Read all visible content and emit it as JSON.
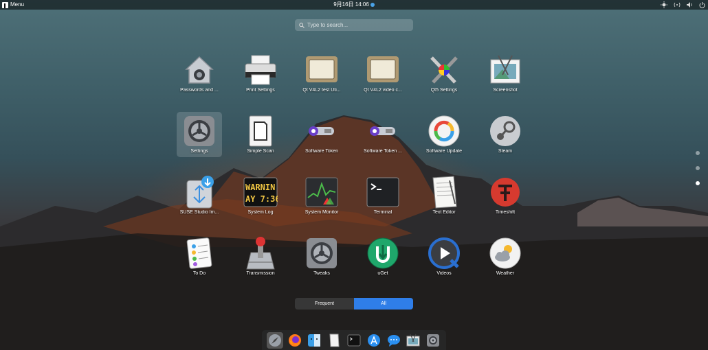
{
  "topbar": {
    "menu_label": "Menu",
    "clock": "9月16日  14:06"
  },
  "search": {
    "placeholder": "Type to search..."
  },
  "apps": [
    {
      "label": "Passwords and ...",
      "icon": "lock-icon"
    },
    {
      "label": "Print Settings",
      "icon": "printer-icon"
    },
    {
      "label": "Qt V4L2 test Uti...",
      "icon": "tv-icon"
    },
    {
      "label": "Qt V4L2 video c...",
      "icon": "tv-icon"
    },
    {
      "label": "Qt5 Settings",
      "icon": "tools-icon"
    },
    {
      "label": "Screenshot",
      "icon": "screenshot-icon"
    },
    {
      "label": "Settings",
      "icon": "gear-icon"
    },
    {
      "label": "Simple Scan",
      "icon": "scanner-icon"
    },
    {
      "label": "Software Token",
      "icon": "usb-token-icon"
    },
    {
      "label": "Software Token ...",
      "icon": "usb-token-icon"
    },
    {
      "label": "Software Update",
      "icon": "update-icon"
    },
    {
      "label": "Steam",
      "icon": "steam-icon"
    },
    {
      "label": "SUSE Studio Im...",
      "icon": "usb-download-icon"
    },
    {
      "label": "System Log",
      "icon": "log-warning-icon"
    },
    {
      "label": "System Monitor",
      "icon": "monitor-chart-icon"
    },
    {
      "label": "Terminal",
      "icon": "terminal-icon"
    },
    {
      "label": "Text Editor",
      "icon": "text-editor-icon"
    },
    {
      "label": "Timeshift",
      "icon": "timeshift-icon"
    },
    {
      "label": "To Do",
      "icon": "todo-icon"
    },
    {
      "label": "Transmission",
      "icon": "transmission-icon"
    },
    {
      "label": "Tweaks",
      "icon": "gear-icon"
    },
    {
      "label": "uGet",
      "icon": "uget-icon"
    },
    {
      "label": "Videos",
      "icon": "videos-icon"
    },
    {
      "label": "Weather",
      "icon": "weather-icon"
    }
  ],
  "log_icon_text": {
    "line1": "WARNIN",
    "line2": "AY 7:36"
  },
  "view_switch": {
    "frequent": "Frequent",
    "all": "All"
  },
  "dock": [
    {
      "icon": "launcher-icon"
    },
    {
      "icon": "firefox-icon"
    },
    {
      "icon": "finder-icon"
    },
    {
      "icon": "document-icon"
    },
    {
      "icon": "terminal-icon"
    },
    {
      "icon": "app-store-icon"
    },
    {
      "icon": "chat-icon"
    },
    {
      "icon": "screenshot-icon"
    },
    {
      "icon": "settings-icon"
    }
  ],
  "colors": {
    "accent": "#2f7ee8",
    "selected_tile": "rgba(255,255,255,0.16)"
  }
}
